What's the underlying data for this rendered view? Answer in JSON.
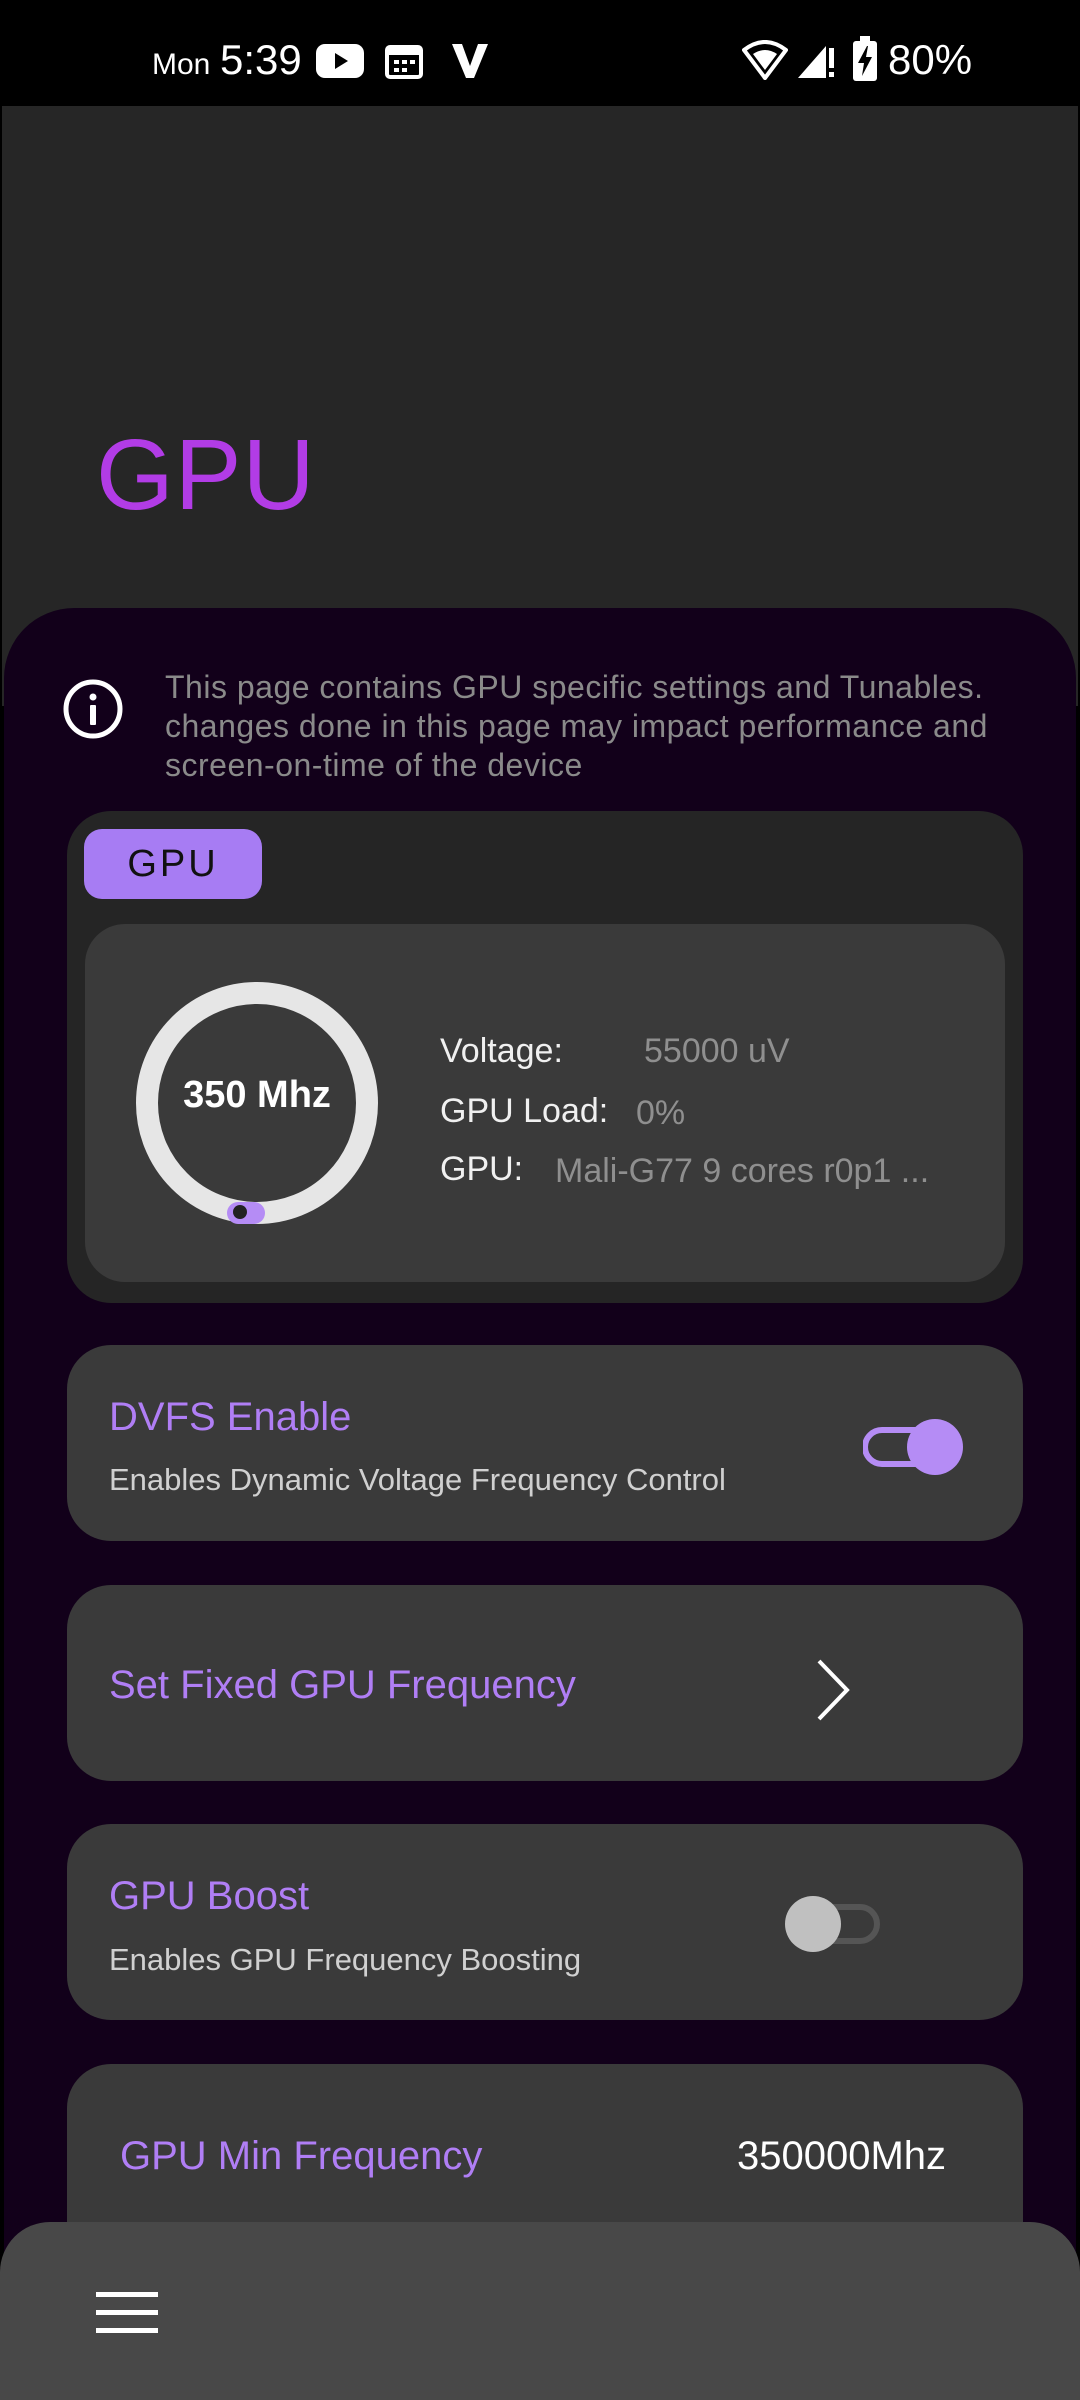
{
  "status_bar": {
    "day": "Mon",
    "time": "5:39",
    "battery": "80%",
    "icons": [
      "youtube-icon",
      "calendar-icon",
      "v-app-icon",
      "wifi-icon",
      "signal-icon",
      "battery-charging-icon"
    ]
  },
  "header": {
    "title": "GPU"
  },
  "info": {
    "text": "This page contains GPU specific settings and Tunables. changes done in this page may impact performance and screen-on-time of the device"
  },
  "gpu_card": {
    "chip_label": "GPU",
    "gauge_value": "350 Mhz",
    "stats": {
      "voltage_label": "Voltage:",
      "voltage_value": "55000 uV",
      "load_label": "GPU Load:",
      "load_value": "0%",
      "gpu_label": "GPU:",
      "gpu_value": "Mali-G77 9 cores r0p1 ..."
    }
  },
  "settings": {
    "dvfs": {
      "title": "DVFS Enable",
      "subtitle": "Enables Dynamic Voltage Frequency Control",
      "enabled": true
    },
    "fixed_freq": {
      "title": "Set Fixed GPU Frequency"
    },
    "boost": {
      "title": "GPU Boost",
      "subtitle": "Enables GPU Frequency Boosting",
      "enabled": false
    },
    "min_freq": {
      "title": "GPU Min Frequency",
      "value": "350000Mhz"
    }
  },
  "colors": {
    "accent": "#a77cf3",
    "title": "#b23ce6",
    "sheet_bg": "#12001a"
  }
}
